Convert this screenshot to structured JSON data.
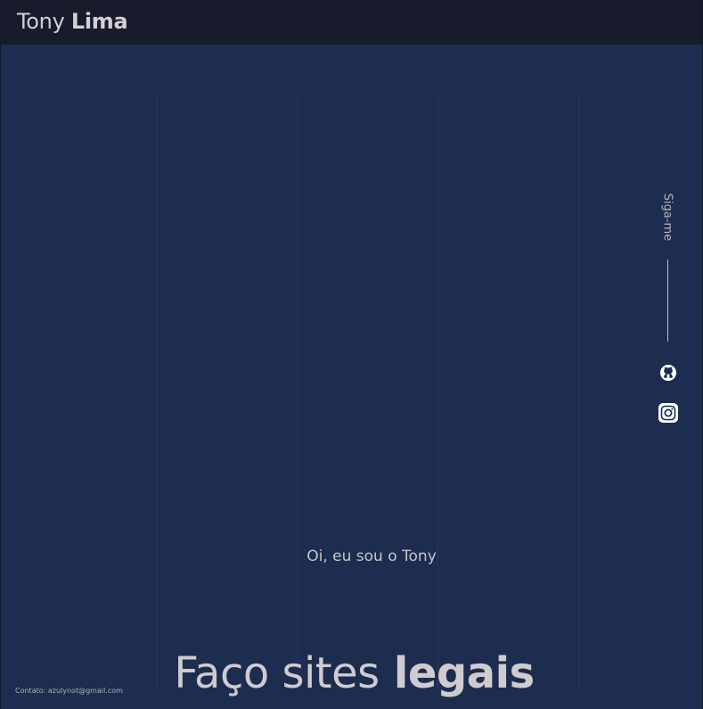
{
  "header": {
    "brand_first": "Tony",
    "brand_last": "Lima"
  },
  "social": {
    "follow_label": "Siga-me",
    "links": [
      {
        "icon": "github-icon"
      },
      {
        "icon": "instagram-icon"
      }
    ]
  },
  "hero": {
    "intro": "Oi, eu sou o Tony",
    "headline_light": "Faço sites",
    "headline_bold": "legais"
  },
  "footer": {
    "contact": "Contato: azulynot@gmail.com"
  },
  "colors": {
    "background": "#1c2d4f",
    "topbar": "#171b2c",
    "text": "#d0cbd0"
  }
}
